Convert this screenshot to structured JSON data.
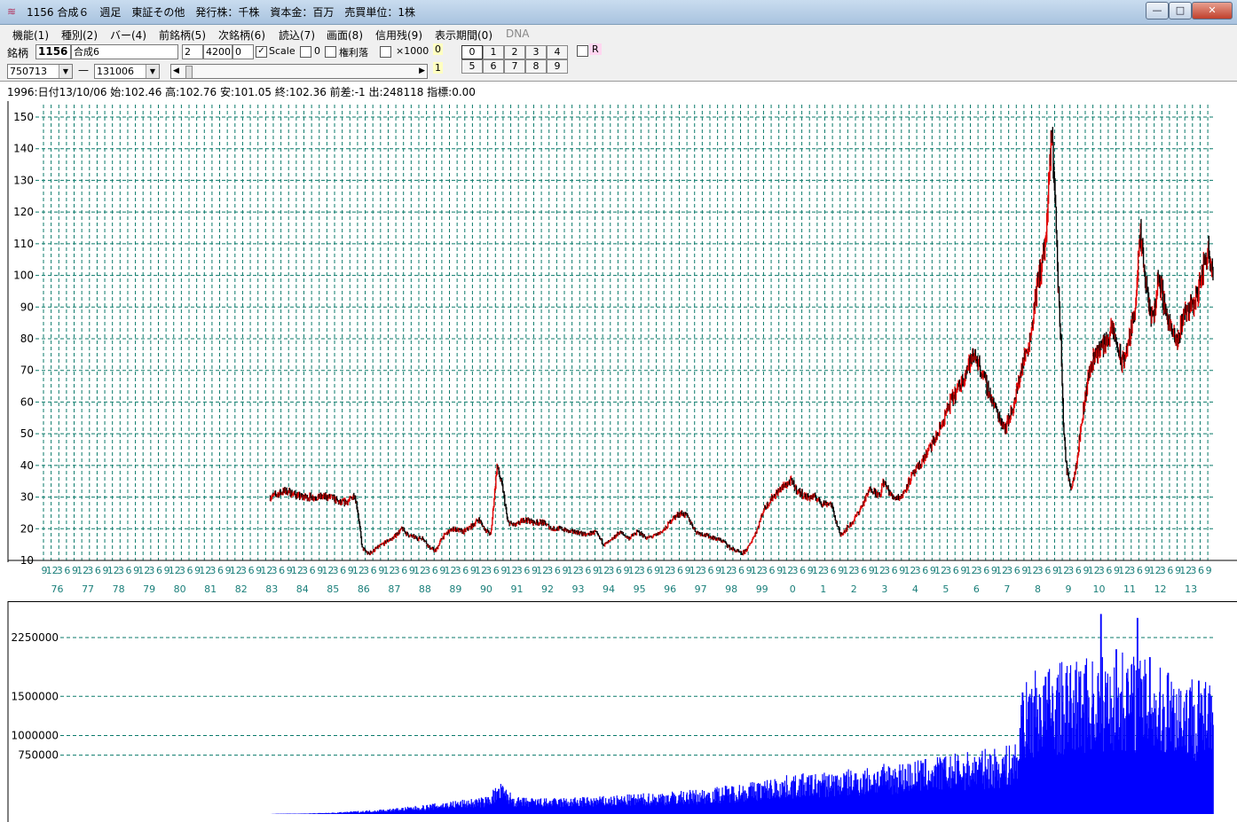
{
  "window": {
    "title": "1156 合成６　週足　東証その他　発行株：千株　資本金：百万　売買単位：1株",
    "minimize_label": "—",
    "maximize_label": "□",
    "close_label": "✕",
    "icon": "chart-app-icon"
  },
  "menu": [
    {
      "label": "機能(1)"
    },
    {
      "label": "種別(2)"
    },
    {
      "label": "バー(4)"
    },
    {
      "label": "前銘柄(5)"
    },
    {
      "label": "次銘柄(6)"
    },
    {
      "label": "読込(7)"
    },
    {
      "label": "画面(8)"
    },
    {
      "label": "信用残(9)"
    },
    {
      "label": "表示期間(0)"
    },
    {
      "label": "DNA"
    }
  ],
  "toolbar": {
    "meigara_label": "銘柄",
    "code_value": "1156",
    "name_value": "合成6",
    "field_a": "2",
    "field_b": "4200",
    "field_c": "0",
    "scale_check": "✓",
    "scale_label": "Scale",
    "zero_label": "0",
    "kenri_label": "権利落",
    "x1000_label": "×1000",
    "flag_top": "0",
    "flag_bottom": "1",
    "start_date": "750713",
    "dash": "—",
    "end_date": "131006",
    "num_row1": [
      "0",
      "1",
      "2",
      "3",
      "4"
    ],
    "num_row2": [
      "5",
      "6",
      "7",
      "8",
      "9"
    ],
    "r_label": "R",
    "scroll_left": "◀",
    "scroll_right": "▶"
  },
  "info": {
    "text": "1996:日付13/10/06 始:102.46 高:102.76 安:101.05 終:102.36 前差:-1 出:248118 指標:0.00"
  },
  "colors": {
    "price_up": "#e00000",
    "price_down": "#000000",
    "grid": "#0a7a6a",
    "volume": "#0000ff"
  },
  "chart_data": [
    {
      "type": "line",
      "xlabel": "",
      "ylabel": "",
      "ylim": [
        10,
        150
      ],
      "yticks": [
        10,
        20,
        30,
        40,
        50,
        60,
        70,
        80,
        90,
        100,
        110,
        120,
        130,
        140,
        150
      ],
      "grid": true,
      "month_tick_pattern": [
        "9",
        "12",
        "3",
        "6"
      ],
      "year_labels": [
        "76",
        "77",
        "78",
        "79",
        "80",
        "81",
        "82",
        "83",
        "84",
        "85",
        "86",
        "87",
        "88",
        "89",
        "90",
        "91",
        "92",
        "93",
        "94",
        "95",
        "96",
        "97",
        "98",
        "99",
        "0",
        "1",
        "2",
        "3",
        "4",
        "5",
        "6",
        "7",
        "8",
        "9",
        "10",
        "11",
        "12",
        "13"
      ],
      "series": [
        {
          "points": [
            [
              1983.0,
              30
            ],
            [
              1983.5,
              32
            ],
            [
              1984.0,
              30
            ],
            [
              1984.5,
              30
            ],
            [
              1985.0,
              30
            ],
            [
              1985.3,
              28
            ],
            [
              1985.6,
              29
            ],
            [
              1985.75,
              31
            ],
            [
              1985.85,
              26
            ],
            [
              1986.0,
              14
            ],
            [
              1986.2,
              12
            ],
            [
              1986.5,
              14
            ],
            [
              1986.8,
              16
            ],
            [
              1987.0,
              17
            ],
            [
              1987.3,
              20
            ],
            [
              1987.5,
              18
            ],
            [
              1987.8,
              17
            ],
            [
              1988.0,
              17
            ],
            [
              1988.2,
              14
            ],
            [
              1988.4,
              13
            ],
            [
              1988.6,
              17
            ],
            [
              1988.8,
              19
            ],
            [
              1989.0,
              20
            ],
            [
              1989.3,
              19
            ],
            [
              1989.6,
              21
            ],
            [
              1989.8,
              23
            ],
            [
              1990.0,
              20
            ],
            [
              1990.2,
              18
            ],
            [
              1990.4,
              40
            ],
            [
              1990.6,
              32
            ],
            [
              1990.75,
              22
            ],
            [
              1991.0,
              21
            ],
            [
              1991.3,
              23
            ],
            [
              1991.6,
              22
            ],
            [
              1991.9,
              22
            ],
            [
              1992.2,
              20
            ],
            [
              1992.5,
              20
            ],
            [
              1992.8,
              19
            ],
            [
              1993.0,
              19
            ],
            [
              1993.3,
              18
            ],
            [
              1993.6,
              19
            ],
            [
              1993.9,
              15
            ],
            [
              1994.1,
              16
            ],
            [
              1994.4,
              19
            ],
            [
              1994.7,
              17
            ],
            [
              1995.0,
              19
            ],
            [
              1995.3,
              17
            ],
            [
              1995.6,
              18
            ],
            [
              1995.9,
              20
            ],
            [
              1996.1,
              23
            ],
            [
              1996.4,
              25
            ],
            [
              1996.6,
              24
            ],
            [
              1996.9,
              19
            ],
            [
              1997.2,
              18
            ],
            [
              1997.5,
              17
            ],
            [
              1997.8,
              16
            ],
            [
              1998.0,
              14
            ],
            [
              1998.2,
              13
            ],
            [
              1998.4,
              12
            ],
            [
              1998.6,
              14
            ],
            [
              1998.9,
              20
            ],
            [
              1999.1,
              26
            ],
            [
              1999.4,
              30
            ],
            [
              1999.7,
              33
            ],
            [
              2000.0,
              35
            ],
            [
              2000.2,
              32
            ],
            [
              2000.5,
              30
            ],
            [
              2000.8,
              30
            ],
            [
              2001.0,
              28
            ],
            [
              2001.3,
              28
            ],
            [
              2001.6,
              18
            ],
            [
              2001.8,
              20
            ],
            [
              2002.0,
              22
            ],
            [
              2002.3,
              27
            ],
            [
              2002.6,
              33
            ],
            [
              2002.9,
              30
            ],
            [
              2003.0,
              35
            ],
            [
              2003.3,
              30
            ],
            [
              2003.6,
              30
            ],
            [
              2003.9,
              36
            ],
            [
              2004.2,
              40
            ],
            [
              2004.5,
              45
            ],
            [
              2004.8,
              50
            ],
            [
              2005.0,
              55
            ],
            [
              2005.2,
              60
            ],
            [
              2005.5,
              65
            ],
            [
              2005.8,
              72
            ],
            [
              2006.0,
              75
            ],
            [
              2006.2,
              70
            ],
            [
              2006.5,
              62
            ],
            [
              2006.8,
              55
            ],
            [
              2007.0,
              52
            ],
            [
              2007.3,
              60
            ],
            [
              2007.5,
              70
            ],
            [
              2007.8,
              80
            ],
            [
              2008.0,
              95
            ],
            [
              2008.3,
              110
            ],
            [
              2008.4,
              125
            ],
            [
              2008.5,
              145
            ],
            [
              2008.6,
              130
            ],
            [
              2008.7,
              100
            ],
            [
              2008.8,
              80
            ],
            [
              2008.9,
              50
            ],
            [
              2009.0,
              38
            ],
            [
              2009.15,
              33
            ],
            [
              2009.3,
              40
            ],
            [
              2009.5,
              55
            ],
            [
              2009.7,
              68
            ],
            [
              2009.9,
              75
            ],
            [
              2010.2,
              78
            ],
            [
              2010.5,
              83
            ],
            [
              2010.8,
              72
            ],
            [
              2011.0,
              78
            ],
            [
              2011.2,
              88
            ],
            [
              2011.4,
              112
            ],
            [
              2011.6,
              95
            ],
            [
              2011.8,
              85
            ],
            [
              2012.0,
              100
            ],
            [
              2012.2,
              90
            ],
            [
              2012.4,
              83
            ],
            [
              2012.6,
              78
            ],
            [
              2012.8,
              88
            ],
            [
              2013.0,
              90
            ],
            [
              2013.2,
              92
            ],
            [
              2013.4,
              100
            ],
            [
              2013.6,
              108
            ],
            [
              2013.77,
              102.36
            ]
          ]
        }
      ]
    },
    {
      "type": "bar",
      "xlabel": "",
      "ylabel": "",
      "yticks": [
        750000,
        1000000,
        1500000,
        2250000
      ],
      "ylim": [
        0,
        2600000
      ],
      "grid": true,
      "profile": [
        [
          1983.0,
          0
        ],
        [
          1983.2,
          3000
        ],
        [
          1984.0,
          5000
        ],
        [
          1985.0,
          12000
        ],
        [
          1986.0,
          30000
        ],
        [
          1987.0,
          50000
        ],
        [
          1988.0,
          80000
        ],
        [
          1989.0,
          120000
        ],
        [
          1990.0,
          150000
        ],
        [
          1990.5,
          280000
        ],
        [
          1991.0,
          150000
        ],
        [
          1992.0,
          140000
        ],
        [
          1993.0,
          150000
        ],
        [
          1994.0,
          160000
        ],
        [
          1995.0,
          180000
        ],
        [
          1996.0,
          200000
        ],
        [
          1997.0,
          220000
        ],
        [
          1998.0,
          260000
        ],
        [
          1999.0,
          300000
        ],
        [
          2000.0,
          350000
        ],
        [
          2001.0,
          370000
        ],
        [
          2002.0,
          400000
        ],
        [
          2003.0,
          440000
        ],
        [
          2004.0,
          480000
        ],
        [
          2005.0,
          520000
        ],
        [
          2006.0,
          560000
        ],
        [
          2007.0,
          600000
        ],
        [
          2007.4,
          650000
        ],
        [
          2007.5,
          1100000
        ],
        [
          2008.0,
          1300000
        ],
        [
          2009.0,
          1350000
        ],
        [
          2010.0,
          1400000
        ],
        [
          2011.0,
          1450000
        ],
        [
          2012.0,
          1300000
        ],
        [
          2013.0,
          1250000
        ],
        [
          2013.77,
          1150000
        ]
      ],
      "peaks": [
        [
          1990.45,
          320000
        ],
        [
          2007.55,
          1550000
        ],
        [
          2008.3,
          1750000
        ],
        [
          2010.1,
          2550000
        ],
        [
          2011.3,
          2500000
        ],
        [
          2011.7,
          2000000
        ],
        [
          2010.6,
          2100000
        ],
        [
          2009.6,
          1900000
        ],
        [
          2012.3,
          1800000
        ],
        [
          2013.3,
          1700000
        ]
      ]
    }
  ]
}
